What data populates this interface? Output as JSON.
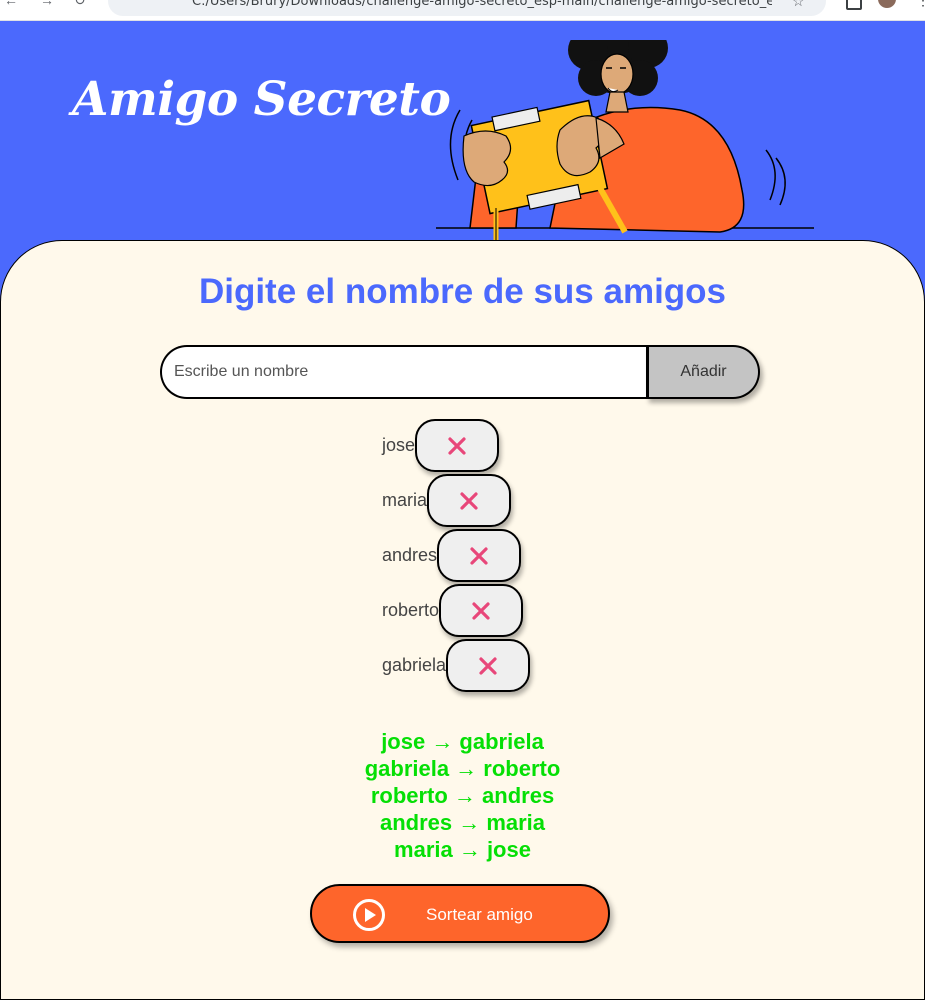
{
  "browser": {
    "url": "C:/Users/Brury/Downloads/challenge-amigo-secreto_esp-main/challenge-amigo-secreto_esp..."
  },
  "header": {
    "title": "Amigo Secreto"
  },
  "main": {
    "heading": "Digite el nombre de sus amigos",
    "input_placeholder": "Escribe un nombre",
    "add_label": "Añadir",
    "friends": [
      "jose",
      "maria",
      "andres",
      "roberto",
      "gabriela"
    ],
    "results": [
      "jose → gabriela",
      "gabriela → roberto",
      "roberto → andres",
      "andres → maria",
      "maria → jose"
    ],
    "draw_label": "Sortear amigo"
  },
  "colors": {
    "banner": "#4B69FD",
    "panel": "#FFF9EB",
    "heading": "#4B69FD",
    "result_text": "#05DF05",
    "draw_button": "#FE652B",
    "delete_icon": "#E8477A"
  },
  "icons": {
    "delete": "close-icon",
    "draw": "play-circle-icon"
  }
}
